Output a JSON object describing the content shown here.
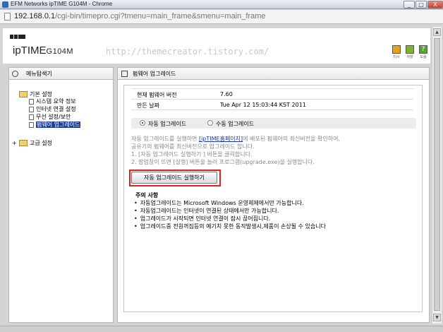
{
  "window": {
    "title": "EFM Networks ipTIME G104M - Chrome",
    "buttons": [
      "_",
      "□",
      "X"
    ]
  },
  "address": {
    "host": "192.168.0.1",
    "path": "/cgi-bin/timepro.cgi?tmenu=main_frame&smenu=main_frame"
  },
  "header": {
    "brand": "ipTIME",
    "model": "G104M",
    "watermark": "http://themecreator.tistory.com/",
    "icons": [
      {
        "name": "logout-icon",
        "label": "티시",
        "color": "#e8a020"
      },
      {
        "name": "save-icon",
        "label": "저장",
        "color": "#7ab52a"
      },
      {
        "name": "help-icon",
        "label": "도움",
        "color": "#5aa03a"
      }
    ]
  },
  "menu": {
    "title": "메뉴탐색기",
    "groups": [
      {
        "label": "기본 설정",
        "items": [
          {
            "label": "시스템 요약 정보"
          },
          {
            "label": "인터넷 연결 설정"
          },
          {
            "label": "무선 설정/보안"
          },
          {
            "label": "펌웨어 업그레이드",
            "selected": true
          }
        ]
      },
      {
        "label": "고급 설정",
        "items": []
      }
    ]
  },
  "main": {
    "title": "펌웨어 업그레이드",
    "info": [
      {
        "key": "현재 펌웨어 버전",
        "value": "7.60"
      },
      {
        "key": "만든 날짜",
        "value": "Tue Apr 12 15:03:44 KST 2011"
      }
    ],
    "mode": {
      "auto_label": "자동 업그레이드",
      "manual_label": "수동 업그레이드",
      "selected": "auto"
    },
    "desc": {
      "line1_pre": "자동 업그레이드를 실행하면 ",
      "line1_link": "[ipTIME홈페이지]",
      "line1_post": "에 배포된 펌웨어의 최신버전을 확인하여,",
      "line2": "공유기의 펌웨어를 최신버전으로 업그레이드 합니다.",
      "line3": "1. [자동 업그레이드 실행하기 ] 버튼을 클릭합니다.",
      "line4": "2. 팝업창이 뜨면 [실행] 버튼을 눌러 프로그램(upgrade.exe)을 실행합니다."
    },
    "run_button": "자동 업그레이드 실행하기",
    "notes_title": "주의 사항",
    "notes": [
      "자동업그레이드는 Microsoft Windows 운영체제에서만 가능합니다.",
      "자동업그레이드는 인터넷이 연결된 상태에서만 가능합니다.",
      "업그레이드가 시작되면 인터넷 연결이 잠시 끊어집니다.",
      "업그레이드중 전원꺼짐등의 예기치 못한 동작발생시,제품이 손상될 수 있습니다"
    ]
  }
}
